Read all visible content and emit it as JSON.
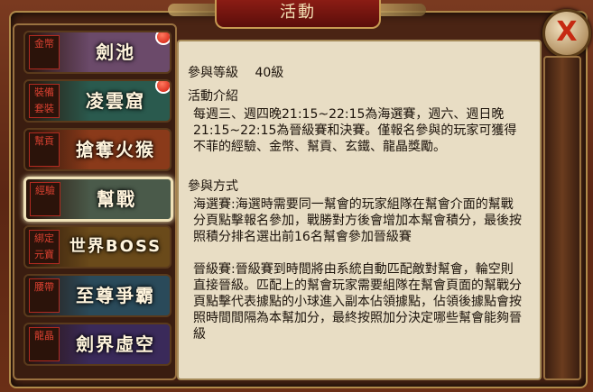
{
  "title": "活動",
  "close_glyph": "X",
  "sidebar": {
    "items": [
      {
        "tag": "金幣",
        "label": "劍池",
        "selected": false,
        "badge": true
      },
      {
        "tag": "裝備 套裝",
        "label": "凌雲窟",
        "selected": false,
        "badge": true
      },
      {
        "tag": "幫貢",
        "label": "搶奪火猴",
        "selected": false,
        "badge": false
      },
      {
        "tag": "經驗",
        "label": "幫戰",
        "selected": true,
        "badge": false
      },
      {
        "tag": "綁定 元寶",
        "label": "世界BOSS",
        "selected": false,
        "badge": false
      },
      {
        "tag": "腰帶",
        "label": "至尊爭霸",
        "selected": false,
        "badge": false
      },
      {
        "tag": "龍晶",
        "label": "劍界虛空",
        "selected": false,
        "badge": false
      }
    ]
  },
  "content": {
    "level_label": "參與等級",
    "level_value": "40級",
    "intro_heading": "活動介紹",
    "intro_text": "每週三、週四晚21:15~22:15為海選賽，週六、週日晚21:15~22:15為晉級賽和決賽。僅報名參與的玩家可獲得不菲的經驗、金幣、幫貢、玄鐵、龍晶獎勵。",
    "method_heading": "參與方式",
    "method_text_1": "海選賽:海選時需要同一幫會的玩家組隊在幫會介面的幫戰分頁點擊報名參加，戰勝對方後會增加本幫會積分，最後按照積分排名選出前16名幫會參加晉級賽",
    "method_text_2": "晉級賽:晉級賽到時間將由系統自動匹配敵對幫會，輪空則直接晉級。匹配上的幫會玩家需要組隊在幫會頁面的幫戰分頁點擊代表據點的小球進入副本佔領據點，佔領後據點會按照時間間隔為本幫加分，最終按照加分決定哪些幫會能夠晉級"
  },
  "colors": {
    "item_backgrounds": [
      "#6b4a6a",
      "#2a5a4e",
      "#8a3a1a",
      "#4a5a4a",
      "#6a4a1a",
      "#2a4a5a",
      "#3a2a5a"
    ]
  }
}
